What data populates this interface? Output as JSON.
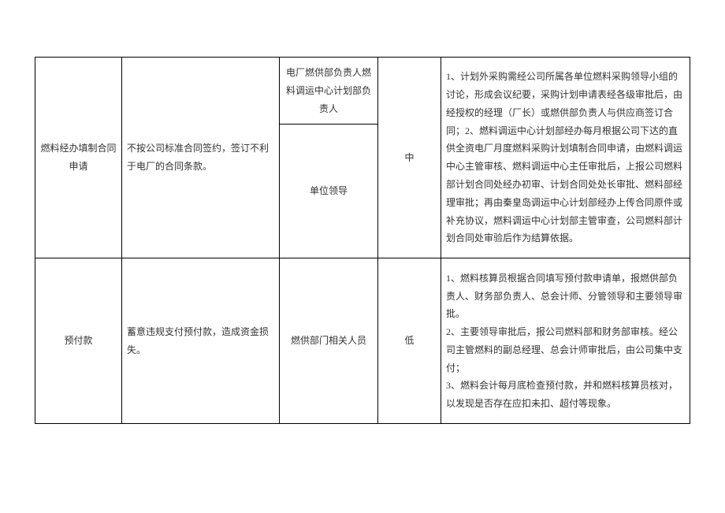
{
  "rows": [
    {
      "col1": "燃料经办填制合同申请",
      "col2": "不按公司标准合同签约，签订不利于电厂的合同条款。",
      "col3_top": "电厂燃供部负责人燃料调运中心计划部负责人",
      "col3_bottom": "单位领导",
      "col4": "中",
      "col5": "1、计划外采购需经公司所属各单位燃料采购领导小组的讨论，形成会议纪要，采购计划申请表经各级审批后，由经授权的经理（厂长）或燃供部负责人与供应商签订合同；2、燃料调运中心计划部经办每月根据公司下达的直供全资电厂月度燃料采购计划填制合同申请，由燃料调运中心主管审核、燃料调运中心主任审批后，上报公司燃料部计划合同处经办初审、计划合同处处长审批、燃料部经理审批；再由秦皇岛调运中心计划部经办上传合同原件或补充协议，燃料调运中心计划部主管审查，公司燃料部计划合同处审验后作为结算依据。"
    },
    {
      "col1": "预付款",
      "col2": "蓄意违规支付预付款，造成资金损失。",
      "col3": "燃供部门相关人员",
      "col4": "低",
      "col5": "1、燃料核算员根据合同填写预付款申请单，报燃供部负责人、财务部负责人、总会计师、分管领导和主要领导审批。\n2、主要领导审批后，报公司燃料部和财务部审核。经公司主管燃料的副总经理、总会计师审批后，由公司集中支付；\n3、燃料会计每月底检查预付款，并和燃料核算员核对，以发现是否存在应扣未扣、超付等现象。"
    }
  ]
}
